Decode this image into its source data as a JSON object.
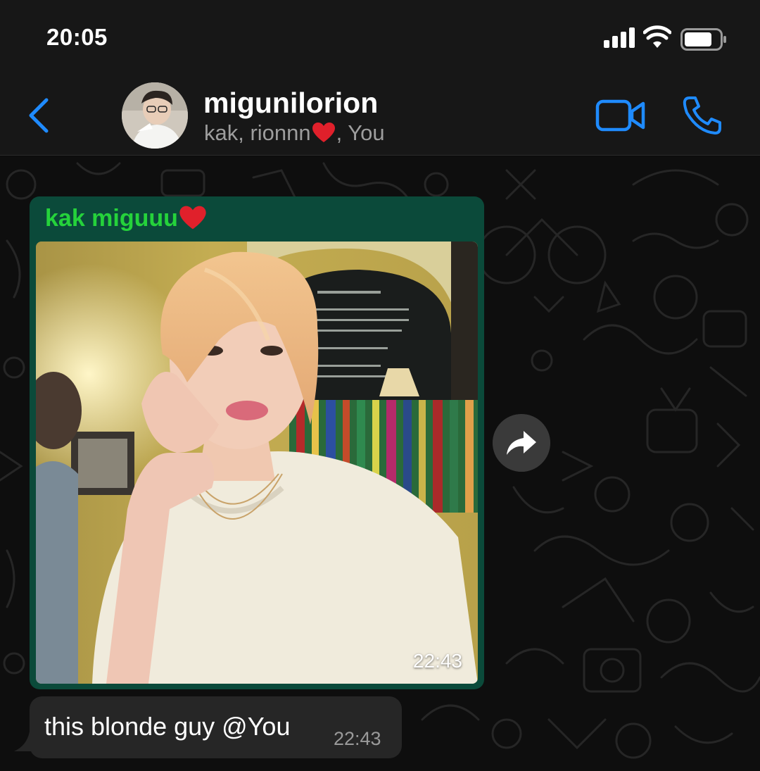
{
  "status_bar": {
    "time": "20:05"
  },
  "header": {
    "title": "migunilorion",
    "subtitle_prefix": "kak, rionnn",
    "subtitle_suffix": ", You"
  },
  "messages": [
    {
      "type": "image",
      "sender": "kak miguuu",
      "time": "22:43"
    },
    {
      "type": "text",
      "text": "this blonde guy @You",
      "time": "22:43"
    }
  ],
  "colors": {
    "accent_blue": "#1f8bff",
    "bubble_green": "#0b4a3a",
    "sender_green": "#25d23b",
    "incoming_bubble": "#262626",
    "heart_red": "#e0202b"
  },
  "icons": [
    "back-chevron-icon",
    "video-call-icon",
    "phone-icon",
    "forward-icon",
    "heart-icon",
    "signal-icon",
    "wifi-icon",
    "battery-icon"
  ]
}
